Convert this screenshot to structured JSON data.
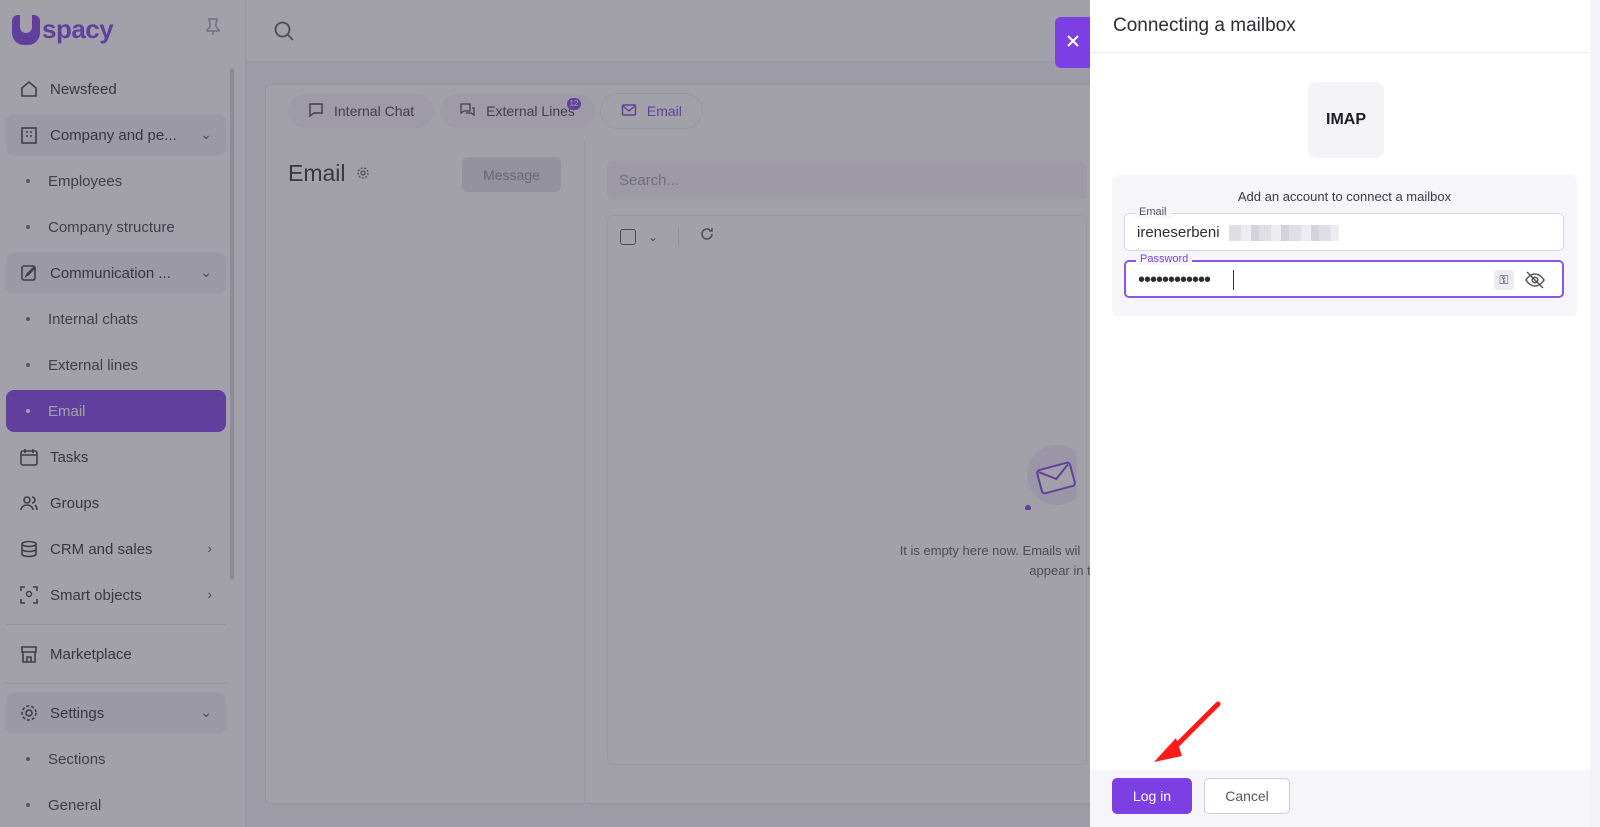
{
  "app": {
    "brand": "spacy",
    "sidebar": {
      "items": [
        {
          "label": "Newsfeed",
          "icon": "home-icon"
        },
        {
          "label": "Company and pe...",
          "icon": "building-icon",
          "expanded": true
        },
        {
          "label": "Employees",
          "sub": true
        },
        {
          "label": "Company structure",
          "sub": true
        },
        {
          "label": "Communication ...",
          "icon": "chat-edit-icon",
          "expanded": true
        },
        {
          "label": "Internal chats",
          "sub": true
        },
        {
          "label": "External lines",
          "sub": true
        },
        {
          "label": "Email",
          "sub": true,
          "active": true
        },
        {
          "label": "Tasks",
          "icon": "calendar-icon"
        },
        {
          "label": "Groups",
          "icon": "users-icon"
        },
        {
          "label": "CRM and sales",
          "icon": "database-icon"
        },
        {
          "label": "Smart objects",
          "icon": "scan-icon"
        },
        {
          "label": "Marketplace",
          "icon": "store-icon"
        },
        {
          "label": "Settings",
          "icon": "gear-icon",
          "expanded": true
        },
        {
          "label": "Sections",
          "sub": true
        },
        {
          "label": "General",
          "sub": true
        }
      ]
    },
    "tabs": [
      {
        "label": "Internal Chat",
        "icon": "chat-bubble-icon"
      },
      {
        "label": "External Lines",
        "icon": "chat-lines-icon",
        "badge": "12"
      },
      {
        "label": "Email",
        "icon": "envelope-icon",
        "active": true
      }
    ],
    "email_pane": {
      "title": "Email",
      "message_button": "Message",
      "search_placeholder": "Search...",
      "empty_text_1": "It is empty here now. Emails wil",
      "empty_text_2": "appear in t"
    }
  },
  "drawer": {
    "title": "Connecting a mailbox",
    "provider": "IMAP",
    "caption": "Add an account to connect a mailbox",
    "email_label": "Email",
    "email_value": "ireneserbeni",
    "password_label": "Password",
    "password_value": "••••••••••••",
    "login_button": "Log in",
    "cancel_button": "Cancel"
  },
  "colors": {
    "accent": "#7b3fe4",
    "overlay": "#46425480",
    "annotation": "#ff1a1a"
  }
}
